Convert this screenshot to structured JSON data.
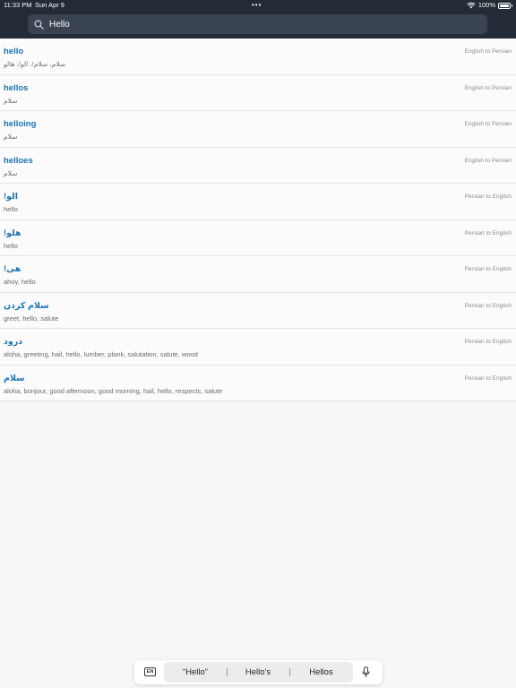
{
  "status": {
    "time": "11:33 PM",
    "date": "Sun Apr 9",
    "dots": "•••",
    "battery": "100%"
  },
  "search": {
    "value": "Hello",
    "placeholder": ""
  },
  "results": [
    {
      "term": "hello",
      "translation": "سلام، سلام!، الو!، هالو",
      "direction": "English to Persian"
    },
    {
      "term": "hellos",
      "translation": "سلام",
      "direction": "English to Persian"
    },
    {
      "term": "helloing",
      "translation": "سلام",
      "direction": "English to Persian"
    },
    {
      "term": "helloes",
      "translation": "سلام",
      "direction": "English to Persian"
    },
    {
      "term": "!الو",
      "translation": "hello",
      "direction": "Persian to English"
    },
    {
      "term": "!هلو",
      "translation": "hello",
      "direction": "Persian to English"
    },
    {
      "term": "!هی",
      "translation": "ahoy, hello",
      "direction": "Persian to English"
    },
    {
      "term": "سلام کردن",
      "translation": "greet, hello, salute",
      "direction": "Persian to English"
    },
    {
      "term": "درود",
      "translation": "aloha, greeting, hail, hello, lumber, plank, salutation, salute, wood",
      "direction": "Persian to English"
    },
    {
      "term": "سلام",
      "translation": "aloha, bonjour, good afternoon, good morning, hail, hello, respects, salute",
      "direction": "Persian to English"
    }
  ],
  "keyboard": {
    "lang_key": "EN",
    "suggestions": [
      "“Hello”",
      "Hello’s",
      "Hellos"
    ]
  },
  "colors": {
    "topbar": "#232b36",
    "term": "#1a73b3",
    "background": "#f7f7f8"
  },
  "icons": {
    "search": "search-icon",
    "wifi": "wifi-icon",
    "battery": "battery-icon",
    "mic": "microphone-icon"
  }
}
